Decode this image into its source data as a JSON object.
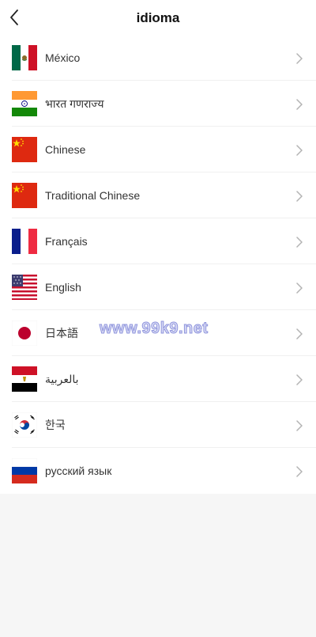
{
  "header": {
    "title": "idioma",
    "back_icon": "chevron-left-icon"
  },
  "languages": [
    {
      "label": "México",
      "flag": "mexico-flag-icon"
    },
    {
      "label": "भारत गणराज्य",
      "flag": "india-flag-icon"
    },
    {
      "label": "Chinese",
      "flag": "china-flag-icon"
    },
    {
      "label": "Traditional Chinese",
      "flag": "china-flag-icon"
    },
    {
      "label": "Français",
      "flag": "france-flag-icon"
    },
    {
      "label": "English",
      "flag": "usa-flag-icon"
    },
    {
      "label": "日本語",
      "flag": "japan-flag-icon"
    },
    {
      "label": "بالعربية",
      "flag": "egypt-flag-icon"
    },
    {
      "label": "한국",
      "flag": "korea-flag-icon"
    },
    {
      "label": "русский язык",
      "flag": "russia-flag-icon"
    }
  ],
  "row_action_icon": "chevron-right-icon",
  "watermark": {
    "text": "www.99k9.net"
  },
  "colors": {
    "header_bg": "#ffffff",
    "page_bg": "#f6f6f6",
    "text": "#333333",
    "divider": "#f0f0f0",
    "chevron": "#b3b3b3"
  }
}
